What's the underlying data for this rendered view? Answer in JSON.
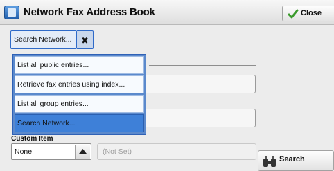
{
  "window": {
    "title": "Network Fax Address Book",
    "close_label": "Close"
  },
  "top_dropdown": {
    "value": "Search Network..."
  },
  "menu": {
    "items": [
      {
        "label": "List all public entries..."
      },
      {
        "label": "Retrieve fax entries using index..."
      },
      {
        "label": "List all group entries..."
      },
      {
        "label": "Search Network...",
        "selected": true
      }
    ]
  },
  "custom_item": {
    "label": "Custom Item",
    "value": "None",
    "value_field": "(Not Set)"
  },
  "search_button": {
    "label": "Search"
  },
  "colors": {
    "accent": "#2f6ac8",
    "selected_item": "#3e80d8"
  }
}
